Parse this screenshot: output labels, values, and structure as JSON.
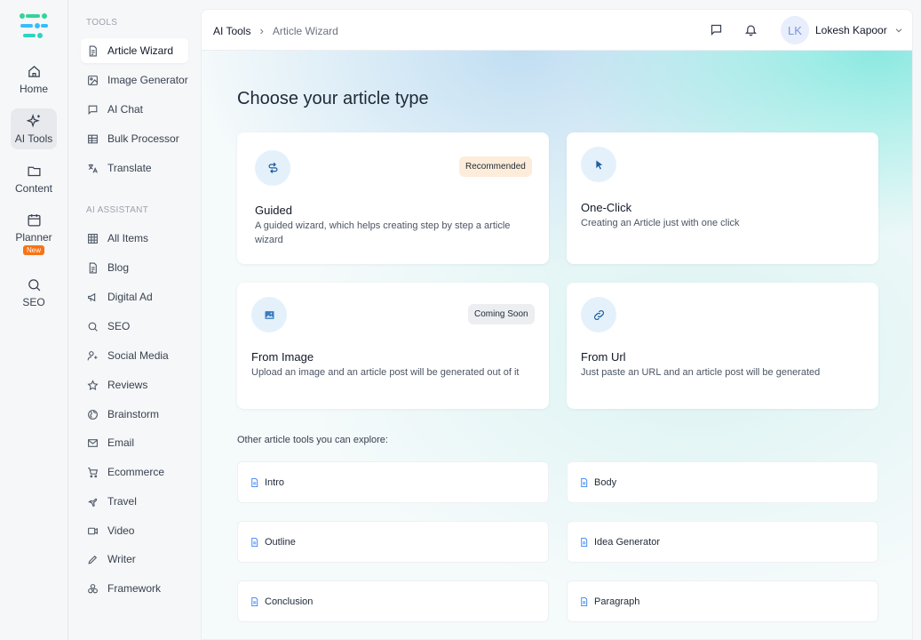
{
  "rail": {
    "items": [
      {
        "label": "Home",
        "icon": "home-icon"
      },
      {
        "label": "AI Tools",
        "icon": "sparkle-icon",
        "active": true
      },
      {
        "label": "Content",
        "icon": "folder-icon"
      },
      {
        "label": "Planner",
        "icon": "calendar-icon",
        "badge": "New"
      },
      {
        "label": "SEO",
        "icon": "search-icon"
      }
    ]
  },
  "sidebar": {
    "tools_heading": "TOOLS",
    "tools": [
      {
        "label": "Article Wizard",
        "icon": "document-icon",
        "active": true
      },
      {
        "label": "Image Generator",
        "icon": "image-icon"
      },
      {
        "label": "AI Chat",
        "icon": "chat-icon"
      },
      {
        "label": "Bulk Processor",
        "icon": "table-icon"
      },
      {
        "label": "Translate",
        "icon": "translate-icon"
      }
    ],
    "assistant_heading": "AI ASSISTANT",
    "assistant": [
      {
        "label": "All Items",
        "icon": "grid-icon"
      },
      {
        "label": "Blog",
        "icon": "document-icon"
      },
      {
        "label": "Digital Ad",
        "icon": "megaphone-icon"
      },
      {
        "label": "SEO",
        "icon": "search-icon"
      },
      {
        "label": "Social Media",
        "icon": "people-icon"
      },
      {
        "label": "Reviews",
        "icon": "star-icon"
      },
      {
        "label": "Brainstorm",
        "icon": "globe-icon"
      },
      {
        "label": "Email",
        "icon": "mail-icon"
      },
      {
        "label": "Ecommerce",
        "icon": "cart-icon"
      },
      {
        "label": "Travel",
        "icon": "plane-icon"
      },
      {
        "label": "Video",
        "icon": "video-icon"
      },
      {
        "label": "Writer",
        "icon": "pen-icon"
      },
      {
        "label": "Framework",
        "icon": "cubes-icon"
      }
    ]
  },
  "topbar": {
    "breadcrumb_root": "AI Tools",
    "breadcrumb_sep": "›",
    "breadcrumb_current": "Article Wizard",
    "user_initials": "LK",
    "user_name": "Lokesh Kapoor"
  },
  "main": {
    "heading": "Choose your article type",
    "cards": {
      "guided": {
        "title": "Guided",
        "desc": "A guided wizard, which helps creating step by step a article wizard",
        "badge": "Recommended"
      },
      "oneclick": {
        "title": "One-Click",
        "desc": "Creating an Article just with one click"
      },
      "image": {
        "title": "From Image",
        "desc": "Upload an image and an article post will be generated out of it",
        "badge": "Coming Soon"
      },
      "url": {
        "title": "From Url",
        "desc": "Just paste an URL and an article post will be generated"
      }
    },
    "explore_heading": "Other article tools you can explore:",
    "tools": [
      "Intro",
      "Body",
      "Outline",
      "Idea Generator",
      "Conclusion",
      "Paragraph"
    ]
  },
  "colors": {
    "accent": "#1e5fa0",
    "badge_new": "#f97316",
    "recommended_bg": "#fdecd9"
  }
}
